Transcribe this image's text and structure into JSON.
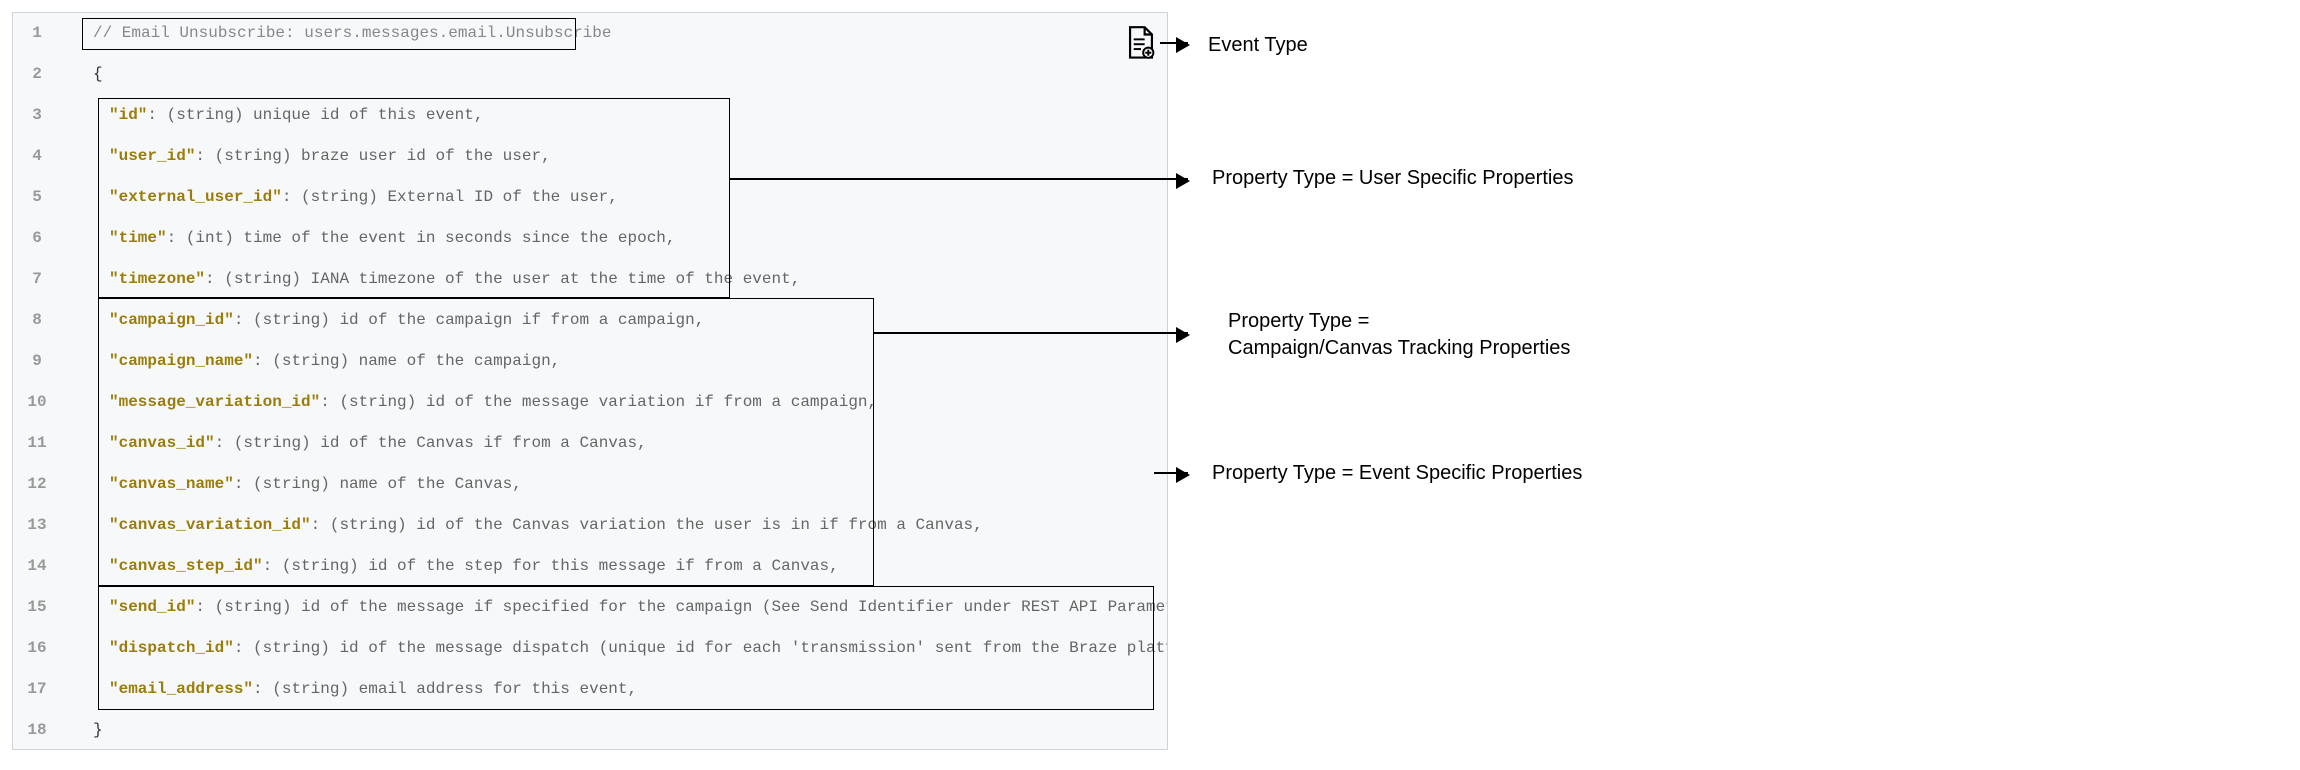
{
  "annotations": {
    "event_type": "Event Type",
    "user_props": "Property Type = User Specific Properties",
    "tracking_props_line1": "Property Type =",
    "tracking_props_line2": "Campaign/Canvas Tracking Properties",
    "event_props": "Property Type = Event Specific Properties"
  },
  "code": {
    "line_numbers": [
      "1",
      "2",
      "3",
      "4",
      "5",
      "6",
      "7",
      "8",
      "9",
      "10",
      "11",
      "12",
      "13",
      "14",
      "15",
      "16",
      "17",
      "18"
    ],
    "comment": "// Email Unsubscribe: users.messages.email.Unsubscribe",
    "open_brace": "{",
    "close_brace": "}",
    "rows": [
      {
        "key": "\"id\"",
        "desc": ": (string) unique id of this event,"
      },
      {
        "key": "\"user_id\"",
        "desc": ": (string) braze user id of the user,"
      },
      {
        "key": "\"external_user_id\"",
        "desc": ": (string) External ID of the user,"
      },
      {
        "key": "\"time\"",
        "desc": ": (int) time of the event in seconds since the epoch,"
      },
      {
        "key": "\"timezone\"",
        "desc": ": (string) IANA timezone of the user at the time of the event,"
      },
      {
        "key": "\"campaign_id\"",
        "desc": ": (string) id of the campaign if from a campaign,"
      },
      {
        "key": "\"campaign_name\"",
        "desc": ": (string) name of the campaign,"
      },
      {
        "key": "\"message_variation_id\"",
        "desc": ": (string) id of the message variation if from a campaign,"
      },
      {
        "key": "\"canvas_id\"",
        "desc": ": (string) id of the Canvas if from a Canvas,"
      },
      {
        "key": "\"canvas_name\"",
        "desc": ": (string) name of the Canvas,"
      },
      {
        "key": "\"canvas_variation_id\"",
        "desc": ": (string) id of the Canvas variation the user is in if from a Canvas,"
      },
      {
        "key": "\"canvas_step_id\"",
        "desc": ": (string) id of the step for this message if from a Canvas,"
      },
      {
        "key": "\"send_id\"",
        "desc": ": (string) id of the message if specified for the campaign (See Send Identifier under REST API Parameter Definition"
      },
      {
        "key": "\"dispatch_id\"",
        "desc": ": (string) id of the message dispatch (unique id for each 'transmission' sent from the Braze platform). Users w"
      },
      {
        "key": "\"email_address\"",
        "desc": ": (string) email address for this event,"
      }
    ]
  }
}
